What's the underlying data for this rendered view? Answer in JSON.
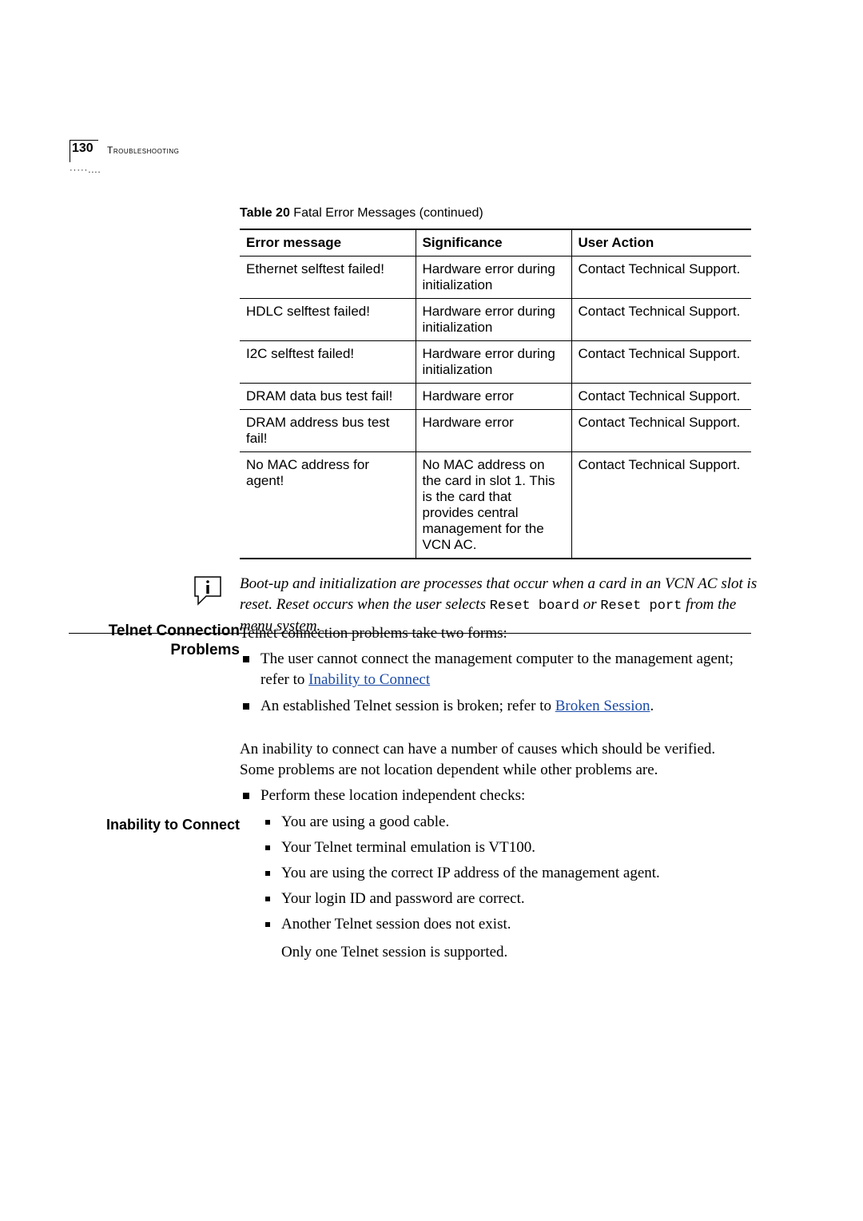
{
  "header": {
    "page_number": "130",
    "chapter": "Troubleshooting"
  },
  "table": {
    "caption_label": "Table 20",
    "caption_rest": "   Fatal Error Messages (continued)",
    "head": {
      "c1": "Error message",
      "c2": "Significance",
      "c3": "User Action"
    },
    "rows": [
      {
        "c1": "Ethernet selftest failed!",
        "c2": "Hardware error during initialization",
        "c3": "Contact Technical Support."
      },
      {
        "c1": "HDLC selftest failed!",
        "c2": "Hardware error during initialization",
        "c3": "Contact Technical Support."
      },
      {
        "c1": "I2C selftest failed!",
        "c2": "Hardware error during initialization",
        "c3": "Contact Technical Support."
      },
      {
        "c1": "DRAM data bus test fail!",
        "c2": "Hardware error",
        "c3": "Contact Technical Support."
      },
      {
        "c1": "DRAM address bus test fail!",
        "c2": "Hardware error",
        "c3": "Contact Technical Support."
      },
      {
        "c1": "No MAC address for agent!",
        "c2": "No MAC address on the card in slot 1. This is the card that provides central management for the VCN AC.",
        "c3": "Contact Technical Support."
      }
    ]
  },
  "note": {
    "seg1": "Boot-up and initialization are processes that occur when a card in an VCN AC slot is reset. Reset occurs when the user selects ",
    "mono1": "Reset board",
    "seg2": " or ",
    "mono2": "Reset port",
    "seg3": " from the menu system."
  },
  "sections": {
    "telnet_heading_l1": "Telnet Connection",
    "telnet_heading_l2": "Problems",
    "telnet_intro": "Telnet connection problems take two forms:",
    "telnet_b1_pre": "The user cannot connect the management computer to the management agent; refer to ",
    "telnet_b1_link": "Inability to Connect",
    "telnet_b2_pre": "An established Telnet session is broken; refer to ",
    "telnet_b2_link": "Broken Session",
    "telnet_b2_post": ".",
    "inability_heading": "Inability to Connect",
    "inability_intro": "An inability to connect can have a number of causes which should be verified. Some problems are not location dependent while other problems are.",
    "inability_b1": "Perform these location independent checks:",
    "checks": [
      "You are using a good cable.",
      "Your Telnet terminal emulation is VT100.",
      "You are using the correct IP address of the management agent.",
      "Your login ID and password are correct.",
      "Another Telnet session does not exist."
    ],
    "checks_tail": "Only one Telnet session is supported."
  }
}
